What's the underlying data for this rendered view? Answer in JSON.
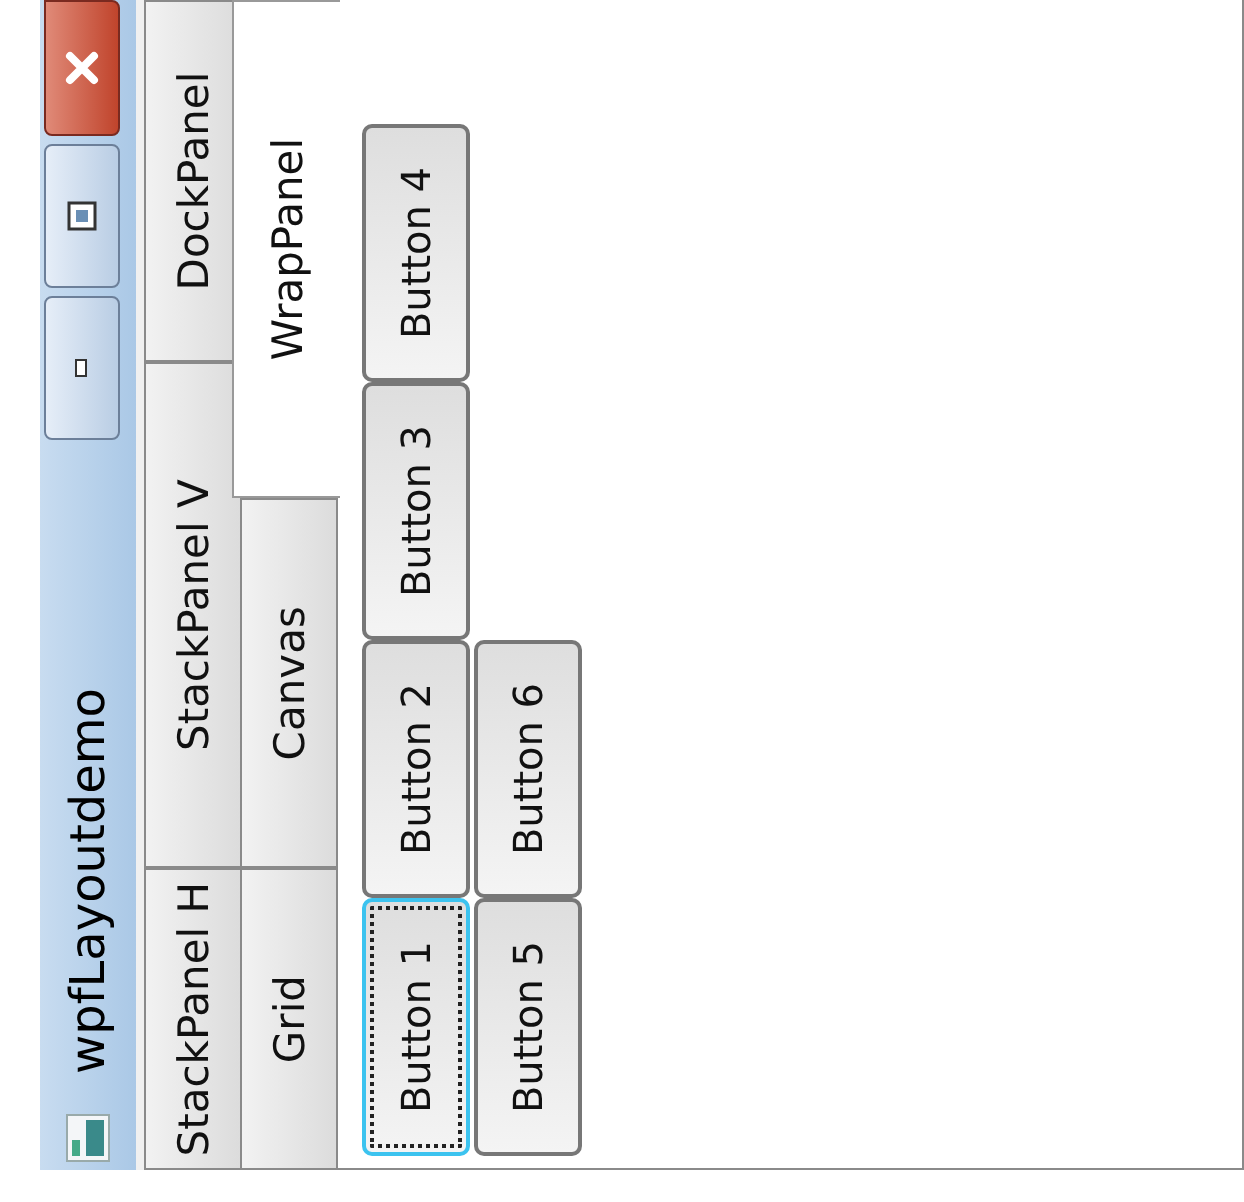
{
  "window": {
    "title": "wpfLayoutdemo"
  },
  "tab_rows": [
    {
      "tabs": [
        {
          "label": "StackPanel H",
          "selected": false
        },
        {
          "label": "StackPanel V",
          "selected": false
        },
        {
          "label": "DockPanel",
          "selected": false
        }
      ]
    },
    {
      "tabs": [
        {
          "label": "Grid",
          "selected": false
        },
        {
          "label": "Canvas",
          "selected": false
        },
        {
          "label": "WrapPanel",
          "selected": true
        }
      ]
    }
  ],
  "buttons": [
    {
      "label": "Button 1",
      "focused": true
    },
    {
      "label": "Button 2",
      "focused": false
    },
    {
      "label": "Button 3",
      "focused": false
    },
    {
      "label": "Button 4",
      "focused": false
    },
    {
      "label": "Button 5",
      "focused": false
    },
    {
      "label": "Button 6",
      "focused": false
    }
  ]
}
